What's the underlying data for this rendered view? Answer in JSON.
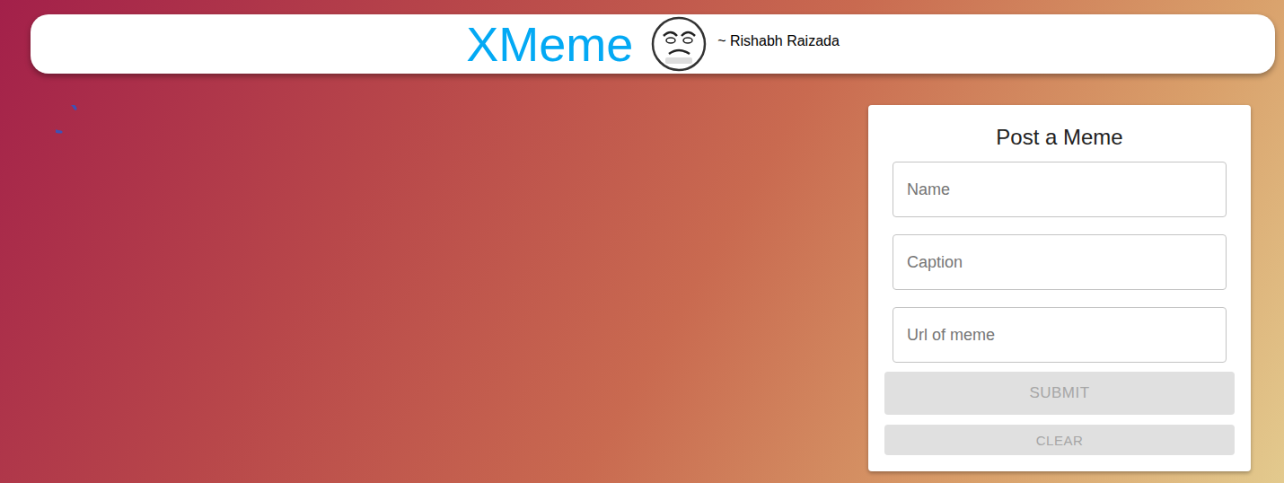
{
  "header": {
    "title": "XMeme",
    "author": "~ Rishabh Raizada"
  },
  "memes": {
    "loading": true
  },
  "form": {
    "title": "Post a Meme",
    "fields": [
      {
        "placeholder": "Name",
        "value": ""
      },
      {
        "placeholder": "Caption",
        "value": ""
      },
      {
        "placeholder": "Url of meme",
        "value": ""
      }
    ],
    "buttons": [
      {
        "label": "SUBMIT",
        "disabled": true,
        "kind": "primary"
      },
      {
        "label": "CLEAR",
        "disabled": true,
        "kind": "secondary"
      }
    ]
  }
}
